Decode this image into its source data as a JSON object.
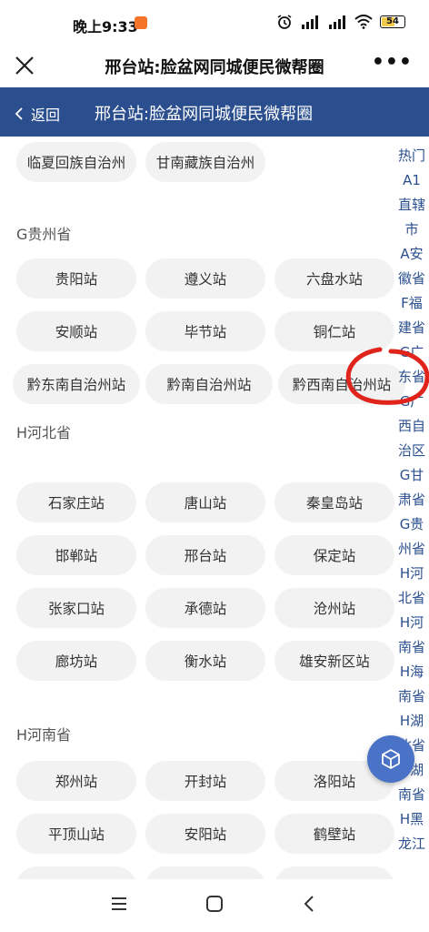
{
  "status": {
    "time": "晚上9:33",
    "battery": "54",
    "signal1": "HD",
    "signal2": "HD"
  },
  "title_bar": {
    "title": "邢台站:脸盆网同城便民微帮圈"
  },
  "blue_bar": {
    "back_label": "返回",
    "title": "邢台站:脸盆网同城便民微帮圈"
  },
  "top_row": [
    "临夏回族自治州",
    "甘南藏族自治州"
  ],
  "sections": [
    {
      "header": "G贵州省",
      "rows": [
        [
          "贵阳站",
          "遵义站",
          "六盘水站"
        ],
        [
          "安顺站",
          "毕节站",
          "铜仁站"
        ],
        [
          "黔东南自治州站",
          "黔南自治州站",
          "黔西南自治州站"
        ]
      ]
    },
    {
      "header": "H河北省",
      "rows": [
        [
          "石家庄站",
          "唐山站",
          "秦皇岛站"
        ],
        [
          "邯郸站",
          "邢台站",
          "保定站"
        ],
        [
          "张家口站",
          "承德站",
          "沧州站"
        ],
        [
          "廊坊站",
          "衡水站",
          "雄安新区站"
        ]
      ]
    },
    {
      "header": "H河南省",
      "rows": [
        [
          "郑州站",
          "开封站",
          "洛阳站"
        ],
        [
          "平顶山站",
          "安阳站",
          "鹤壁站"
        ]
      ]
    }
  ],
  "index_letters": [
    "热门",
    "A1",
    "直辖",
    "市",
    "A安",
    "徽省",
    "F福",
    "建省",
    "G广",
    "东省",
    "G广",
    "西自",
    "治区",
    "G甘",
    "肃省",
    "G贵",
    "州省",
    "H河",
    "北省",
    "H河",
    "南省",
    "H海",
    "南省",
    "H湖",
    "北省",
    "H湖",
    "南省",
    "H黑",
    "龙江"
  ],
  "colors": {
    "nav_blue": "#2b4f8e",
    "chip_bg": "#f2f2f2",
    "index_text": "#2b4f8e",
    "annotation_red": "#e0241b"
  },
  "icons": {
    "close": "close-icon",
    "more": "more-icon",
    "back": "chevron-left-icon",
    "fab": "cube-icon"
  }
}
